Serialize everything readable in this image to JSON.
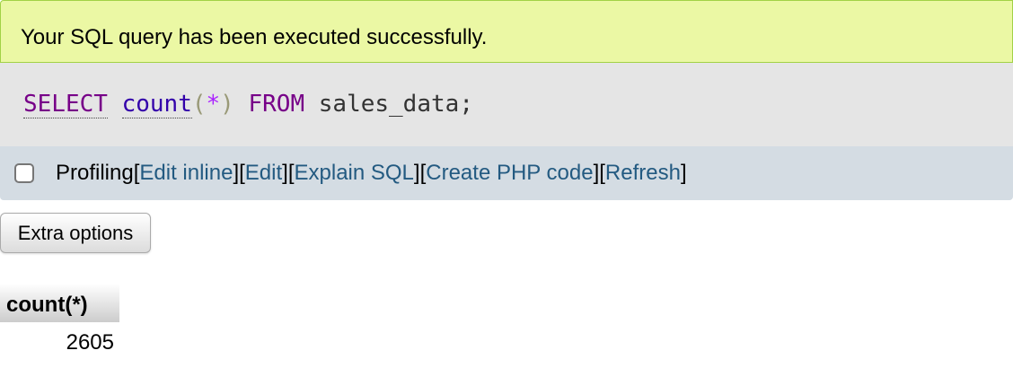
{
  "message": {
    "success_text": "Your SQL query has been executed successfully."
  },
  "sql": {
    "keyword_select": "SELECT",
    "function_count": "count",
    "paren_open": "(",
    "star": "*",
    "paren_close": ")",
    "keyword_from": "FROM",
    "table_name": "sales_data",
    "semicolon": ";"
  },
  "actions": {
    "profiling_label": "Profiling",
    "edit_inline": "Edit inline",
    "edit": "Edit",
    "explain_sql": "Explain SQL",
    "create_php_code": "Create PHP code",
    "refresh": "Refresh",
    "bracket_open": "[",
    "bracket_close": "]"
  },
  "extra_options_label": "Extra options",
  "result": {
    "columns": [
      "count(*)"
    ],
    "rows": [
      [
        "2605"
      ]
    ]
  },
  "colors": {
    "success_bg": "#ebf8a4",
    "sql_bg": "#e5e5e5",
    "actions_bg": "#d4dce3",
    "link": "#235a81",
    "sql_keyword": "#770088"
  }
}
